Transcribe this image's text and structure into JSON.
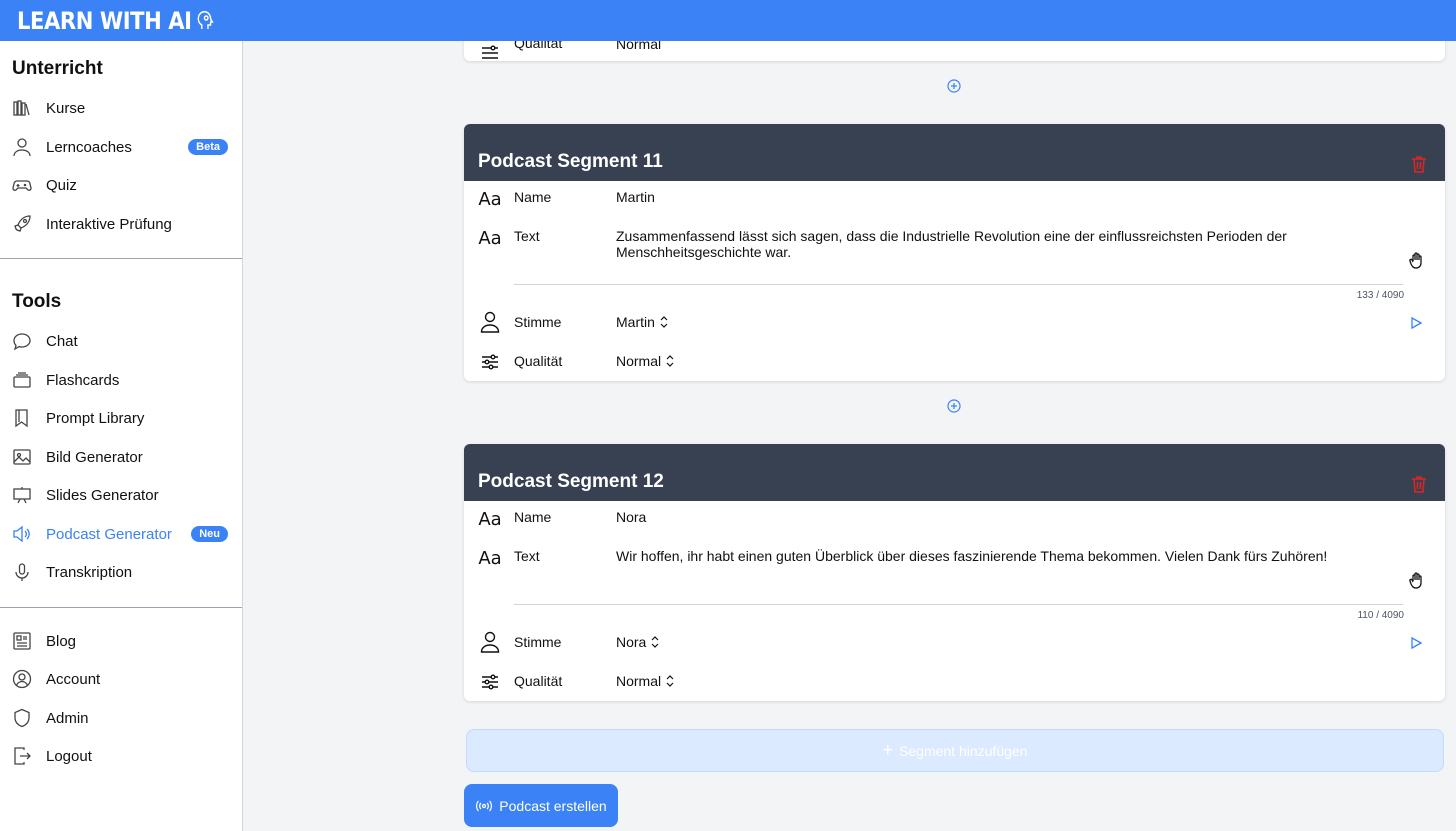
{
  "app": {
    "title": "LEARN WITH AI"
  },
  "sidebar": {
    "section1": "Unterricht",
    "section2": "Tools",
    "items1": [
      {
        "label": "Kurse",
        "icon": "books-icon"
      },
      {
        "label": "Lerncoaches",
        "icon": "user-icon",
        "badge": "Beta"
      },
      {
        "label": "Quiz",
        "icon": "gamepad-icon"
      },
      {
        "label": "Interaktive Prüfung",
        "icon": "rocket-icon"
      }
    ],
    "items2": [
      {
        "label": "Chat",
        "icon": "chat-icon"
      },
      {
        "label": "Flashcards",
        "icon": "cards-icon"
      },
      {
        "label": "Prompt Library",
        "icon": "bookmark-icon"
      },
      {
        "label": "Bild Generator",
        "icon": "image-icon"
      },
      {
        "label": "Slides Generator",
        "icon": "presentation-icon"
      },
      {
        "label": "Podcast Generator",
        "icon": "speaker-icon",
        "badge": "Neu",
        "active": true
      },
      {
        "label": "Transkription",
        "icon": "microphone-icon"
      }
    ],
    "items3": [
      {
        "label": "Blog",
        "icon": "newspaper-icon"
      },
      {
        "label": "Account",
        "icon": "user-circle-icon"
      },
      {
        "label": "Admin",
        "icon": "shield-icon"
      },
      {
        "label": "Logout",
        "icon": "logout-icon"
      }
    ]
  },
  "partial_segment": {
    "quality_label": "Qualität",
    "quality_value": "Normal"
  },
  "segments": [
    {
      "title": "Podcast Segment 11",
      "name_label": "Name",
      "name_value": "Martin",
      "text_label": "Text",
      "text_value": "Zusammenfassend lässt sich sagen, dass die Industrielle Revolution eine der einflussreichsten Perioden der Menschheitsgeschichte war.",
      "char_count": "133 / 4090",
      "voice_label": "Stimme",
      "voice_value": "Martin",
      "quality_label": "Qualität",
      "quality_value": "Normal"
    },
    {
      "title": "Podcast Segment 12",
      "name_label": "Name",
      "name_value": "Nora",
      "text_label": "Text",
      "text_value": "Wir hoffen, ihr habt einen guten Überblick über dieses faszinierende Thema bekommen. Vielen Dank fürs Zuhören!",
      "char_count": "110 / 4090",
      "voice_label": "Stimme",
      "voice_value": "Nora",
      "quality_label": "Qualität",
      "quality_value": "Normal"
    }
  ],
  "actions": {
    "add_segment": "Segment hinzufügen",
    "create_podcast": "Podcast erstellen"
  },
  "colors": {
    "accent": "#3b82f6",
    "card_header": "#374151",
    "danger": "#dc2626"
  }
}
